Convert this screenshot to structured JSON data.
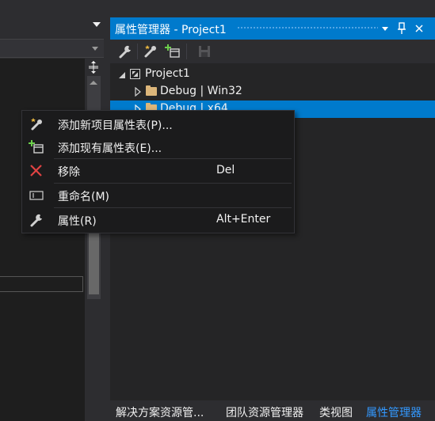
{
  "panel": {
    "title": "属性管理器 - Project1",
    "title_buttons": [
      "▾",
      "📌",
      "✕"
    ]
  },
  "tree": [
    {
      "label": "Project1",
      "expanded": true,
      "icon": "project-icon"
    },
    {
      "label": "Debug | Win32",
      "expanded": false,
      "icon": "folder-icon"
    },
    {
      "label": "Debug | x64",
      "expanded": false,
      "icon": "folder-icon",
      "selected": true
    }
  ],
  "context_menu": {
    "items": [
      {
        "label": "添加新项目属性表(P)...",
        "shortcut": "",
        "icon": "add-new-sheet-icon"
      },
      {
        "label": "添加现有属性表(E)...",
        "shortcut": "",
        "icon": "add-existing-sheet-icon"
      },
      {
        "label": "移除",
        "shortcut": "Del",
        "icon": "remove-icon"
      },
      {
        "label": "重命名(M)",
        "shortcut": "",
        "icon": "rename-icon"
      },
      {
        "label": "属性(R)",
        "shortcut": "Alt+Enter",
        "icon": "wrench-icon"
      }
    ]
  },
  "bottom_tabs": [
    {
      "label": "解决方案资源管...",
      "active": false
    },
    {
      "label": "团队资源管理器",
      "active": false
    },
    {
      "label": "类视图",
      "active": false
    },
    {
      "label": "属性管理器",
      "active": true
    }
  ],
  "colors": {
    "accent": "#007acc",
    "active_tab_text": "#3399ff",
    "remove_icon": "#e04343",
    "folder": "#dcb67a"
  }
}
